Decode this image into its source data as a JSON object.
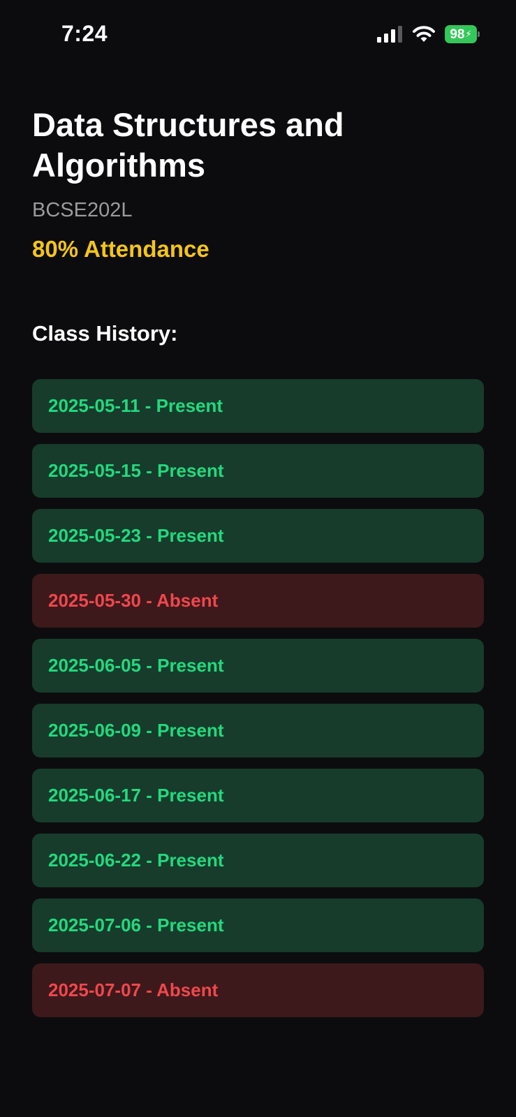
{
  "status_bar": {
    "time": "7:24",
    "battery": "98",
    "icons": [
      "signal-icon",
      "wifi-icon",
      "battery-icon"
    ],
    "battery_color": "#34c759"
  },
  "course": {
    "title": "Data Structures and Algorithms",
    "code": "BCSE202L",
    "attendance": "80% Attendance",
    "attendance_color": "#f5c518"
  },
  "history": {
    "title": "Class History:",
    "colors": {
      "present_bg": "#173c2b",
      "present_text": "#22d97e",
      "absent_bg": "#3d191b",
      "absent_text": "#f0474d"
    },
    "items": [
      {
        "label": "2025-05-11 - Present",
        "status": "present"
      },
      {
        "label": "2025-05-15 - Present",
        "status": "present"
      },
      {
        "label": "2025-05-23 - Present",
        "status": "present"
      },
      {
        "label": "2025-05-30 - Absent",
        "status": "absent"
      },
      {
        "label": "2025-06-05 - Present",
        "status": "present"
      },
      {
        "label": "2025-06-09 - Present",
        "status": "present"
      },
      {
        "label": "2025-06-17 - Present",
        "status": "present"
      },
      {
        "label": "2025-06-22 - Present",
        "status": "present"
      },
      {
        "label": "2025-07-06 - Present",
        "status": "present"
      },
      {
        "label": "2025-07-07 - Absent",
        "status": "absent"
      }
    ]
  }
}
